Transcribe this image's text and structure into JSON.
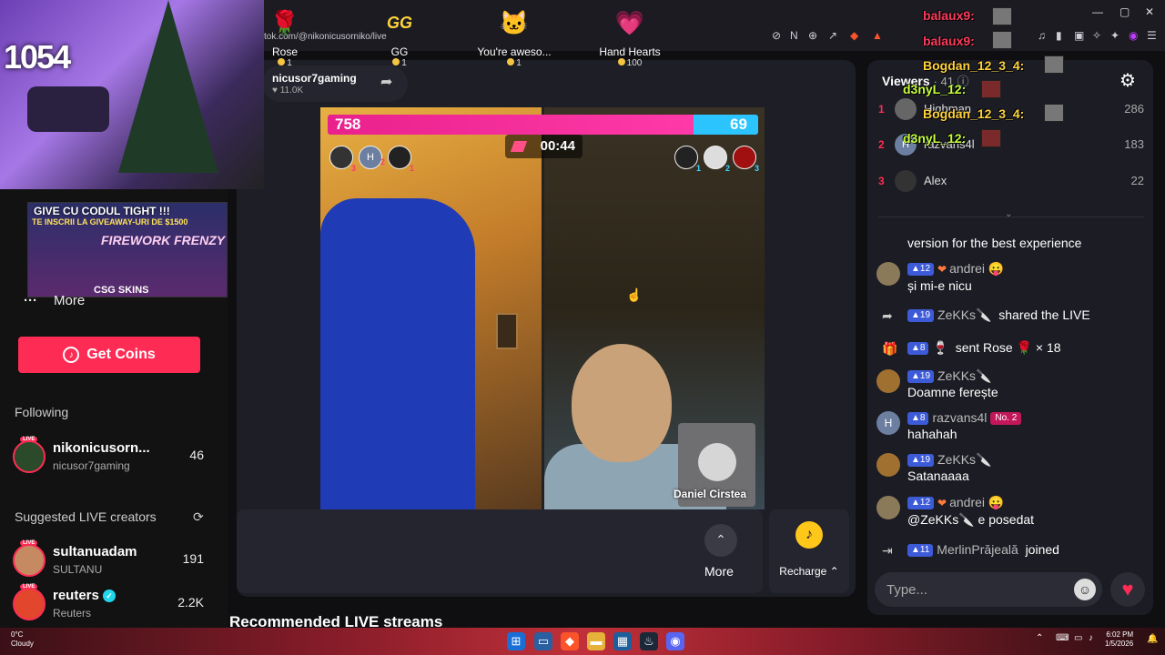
{
  "browser": {
    "url": "tiktok.com/@nikonicusorniko/live",
    "window_controls": [
      "—",
      "▢",
      "✕"
    ]
  },
  "stream_overlay": {
    "counter": "1054",
    "ad": {
      "line1": "GIVE CU CODUL TIGHT !!!",
      "line2": "TE INSCRII LA GIVEAWAY-URI DE $1500",
      "title": "FIREWORK FRENZY",
      "brand": "CSG SKINS"
    },
    "chat_names": [
      {
        "name": "balaux9:",
        "color": "#ff3b5c"
      },
      {
        "name": "balaux9:",
        "color": "#ff3b5c"
      },
      {
        "name": "Bogdan_12_3_4:",
        "color": "#ffd33d"
      },
      {
        "name": "d3nyL_12:",
        "color": "#c6ff3d"
      },
      {
        "name": "Bogdan_12_3_4:",
        "color": "#ffd33d"
      },
      {
        "name": "d3nyL_12:",
        "color": "#c6ff3d"
      }
    ]
  },
  "sidebar": {
    "more_label": "More",
    "get_coins_label": "Get Coins",
    "following_title": "Following",
    "following": [
      {
        "name": "nikonicusorniko",
        "display": "nikonicusorn...",
        "sub": "nicusor7gaming",
        "count": "46"
      }
    ],
    "suggested_title": "Suggested LIVE creators",
    "suggested": [
      {
        "name": "sultanuadam",
        "sub": "SULTANU",
        "count": "191"
      },
      {
        "name": "reuters",
        "sub": "Reuters",
        "count": "2.2K"
      }
    ],
    "live_badge": "LIVE"
  },
  "host": {
    "name": "nicusor7gaming",
    "likes": "11.0K"
  },
  "battle": {
    "score_left": "758",
    "score_right": "69",
    "timer": "00:44",
    "left_ranks": [
      "3",
      "2",
      "1"
    ],
    "right_ranks": [
      "1",
      "2",
      "3"
    ],
    "left_rank_initial": "H",
    "pip_name": "Daniel Cirstea"
  },
  "gifts": [
    {
      "name": "Rose",
      "price": "1",
      "icon": "🌹"
    },
    {
      "name": "GG",
      "price": "1",
      "icon": "GG"
    },
    {
      "name": "You're awesome",
      "display": "You're aweso...",
      "price": "1",
      "icon": "🐱"
    },
    {
      "name": "Hand Hearts",
      "price": "100",
      "icon": "💗"
    }
  ],
  "gift_more_label": "More",
  "recharge_label": "Recharge",
  "recommended_title": "Recommended LIVE streams",
  "viewers": {
    "title": "Viewers",
    "count": "41",
    "list": [
      {
        "rank": "1",
        "name": "Highman",
        "score": "286",
        "initial": ""
      },
      {
        "rank": "2",
        "name": "razvans4l",
        "score": "183",
        "initial": "H"
      },
      {
        "rank": "3",
        "name": "Alex",
        "score": "22",
        "initial": ""
      }
    ]
  },
  "chat": {
    "partial": "version for the best experience",
    "messages": [
      {
        "level": "12",
        "user": "andrei 😛",
        "text": "și mi-e nicu",
        "fan": true
      },
      {
        "level": "19",
        "user": "ZeKKs🔪",
        "text": "shared the LIVE",
        "inline": true,
        "icon": "share"
      },
      {
        "level": "8",
        "user": "🍷",
        "text": "sent Rose 🌹 × 18",
        "inline": true,
        "icon": "gift"
      },
      {
        "level": "19",
        "user": "ZeKKs🔪",
        "text": "Doamne ferește"
      },
      {
        "level": "8",
        "user": "razvans4l",
        "badge": "No. 2",
        "text": "hahahah",
        "initial": "H"
      },
      {
        "level": "19",
        "user": "ZeKKs🔪",
        "text": "Satanaaaa"
      },
      {
        "level": "12",
        "user": "andrei 😛",
        "text": "@ZeKKs🔪 e posedat",
        "fan": true
      },
      {
        "level": "11",
        "user": "MerlinPrăjeală",
        "text": "joined",
        "inline": true,
        "icon": "join"
      }
    ],
    "input_placeholder": "Type..."
  },
  "taskbar": {
    "temp": "0°C",
    "weather": "Cloudy",
    "time": "6:02 PM",
    "date": "1/5/2026"
  },
  "colors": {
    "accent": "#fe2c55",
    "level_badge": "#3d5bd9",
    "score_left": "#e9218d",
    "score_right": "#2bc4ff"
  }
}
